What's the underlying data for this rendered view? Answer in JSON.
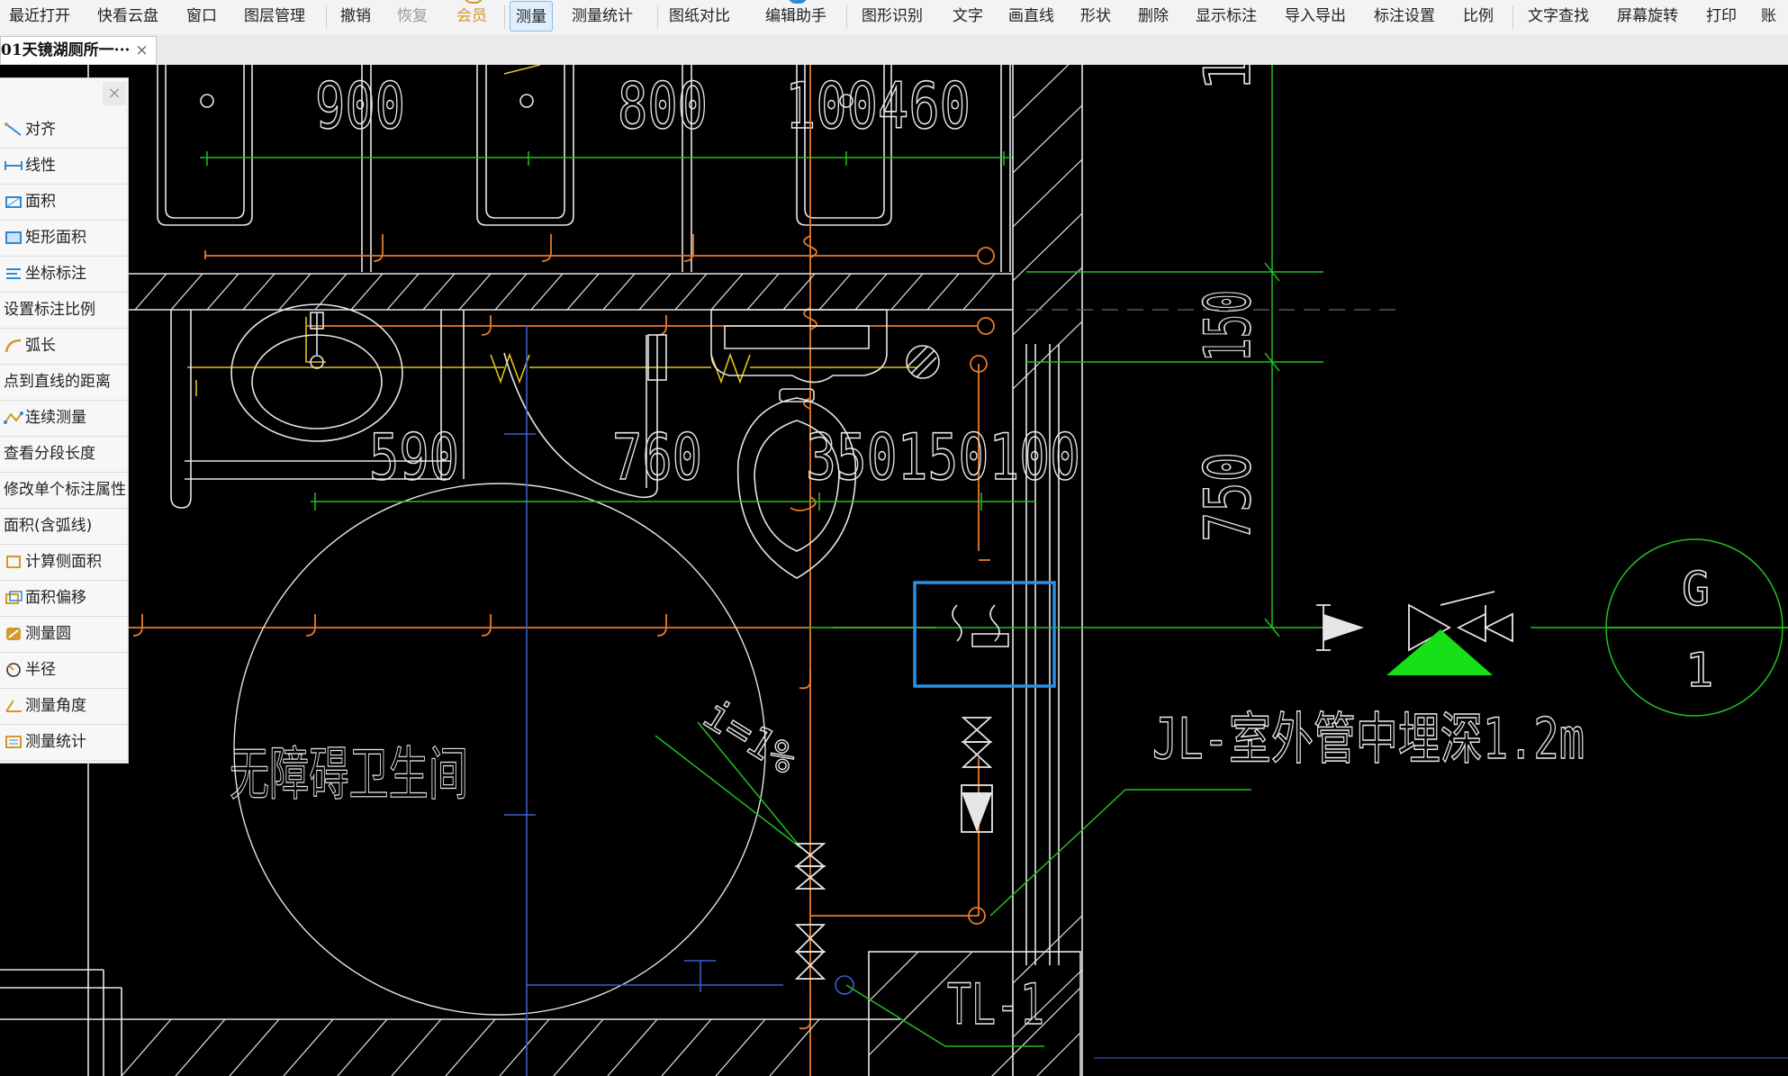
{
  "toolbar": {
    "items": [
      {
        "label": "最近打开",
        "state": "normal"
      },
      {
        "label": "快看云盘",
        "state": "normal"
      },
      {
        "label": "窗口",
        "state": "normal"
      },
      {
        "label": "图层管理",
        "state": "normal"
      },
      {
        "label": "撤销",
        "state": "normal"
      },
      {
        "label": "恢复",
        "state": "disabled"
      },
      {
        "label": "会员",
        "state": "vip"
      },
      {
        "label": "测量",
        "state": "active"
      },
      {
        "label": "测量统计",
        "state": "normal"
      },
      {
        "label": "图纸对比",
        "state": "normal"
      },
      {
        "label": "编辑助手",
        "state": "normal"
      },
      {
        "label": "图形识别",
        "state": "normal"
      },
      {
        "label": "文字",
        "state": "normal"
      },
      {
        "label": "画直线",
        "state": "normal"
      },
      {
        "label": "形状",
        "state": "normal"
      },
      {
        "label": "删除",
        "state": "normal"
      },
      {
        "label": "显示标注",
        "state": "normal"
      },
      {
        "label": "导入导出",
        "state": "normal"
      },
      {
        "label": "标注设置",
        "state": "normal"
      },
      {
        "label": "比例",
        "state": "normal"
      },
      {
        "label": "文字查找",
        "state": "normal"
      },
      {
        "label": "屏幕旋转",
        "state": "normal"
      },
      {
        "label": "打印",
        "state": "normal"
      },
      {
        "label": "账",
        "state": "normal"
      }
    ]
  },
  "tab": {
    "title": "01天镜湖厕所一···",
    "close": "×"
  },
  "panel": {
    "close": "×",
    "items": [
      {
        "label": "对齐",
        "icon": "align-icon"
      },
      {
        "label": "线性",
        "icon": "linear-dimension-icon"
      },
      {
        "label": "面积",
        "icon": "area-icon"
      },
      {
        "label": "矩形面积",
        "icon": "rect-area-icon"
      },
      {
        "label": "坐标标注",
        "icon": "coordinate-icon"
      },
      {
        "label": "设置标注比例",
        "icon": "none"
      },
      {
        "label": "弧长",
        "icon": "arc-length-icon"
      },
      {
        "label": "点到直线的距离",
        "icon": "none"
      },
      {
        "label": "连续测量",
        "icon": "continuous-measure-icon"
      },
      {
        "label": "查看分段长度",
        "icon": "none"
      },
      {
        "label": "修改单个标注属性",
        "icon": "none"
      },
      {
        "label": "面积(含弧线)",
        "icon": "none"
      },
      {
        "label": "计算侧面积",
        "icon": "side-area-icon"
      },
      {
        "label": "面积偏移",
        "icon": "area-offset-icon"
      },
      {
        "label": "测量圆",
        "icon": "measure-circle-icon"
      },
      {
        "label": "半径",
        "icon": "radius-icon"
      },
      {
        "label": "测量角度",
        "icon": "measure-angle-icon"
      },
      {
        "label": "测量统计",
        "icon": "measure-stats-icon"
      }
    ]
  },
  "drawing": {
    "dims_top": [
      "900",
      "800",
      "100460"
    ],
    "dims_mid": [
      "590",
      "760",
      "350150100"
    ],
    "dims_right": [
      "150",
      "750"
    ],
    "dim_right_top_partial": "1",
    "room_label": "无障碍卫生间",
    "slope_label": "i=1%",
    "pipe_label": "JL-室外管中埋深1.2m",
    "riser_label": "TL-1",
    "grid_top": "G",
    "grid_bottom": "1",
    "colors": {
      "white_lines": "#e6e6e6",
      "orange_pipe": "#e87a2c",
      "green_lines": "#22c022",
      "yellow": "#e5c21c",
      "blue": "#3a5fd0",
      "select_box": "#2a90e6",
      "triangle": "#18e018"
    }
  }
}
